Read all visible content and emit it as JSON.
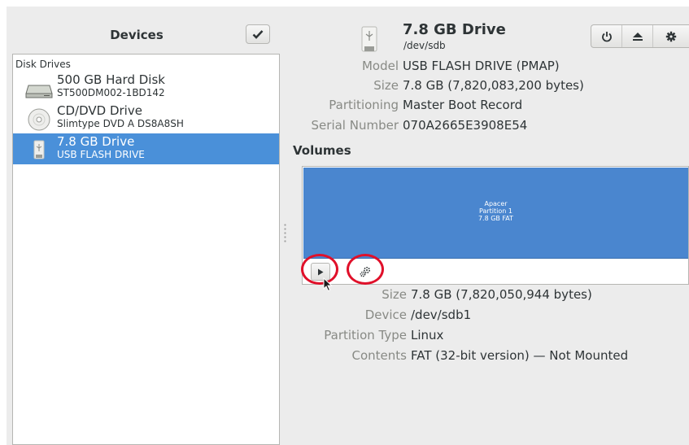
{
  "left_pane": {
    "title": "Devices",
    "section_header": "Disk Drives",
    "devices": [
      {
        "name": "500 GB Hard Disk",
        "sub": "ST500DM002-1BD142",
        "icon": "hard-disk-icon"
      },
      {
        "name": "CD/DVD Drive",
        "sub": "Slimtype DVD A  DS8A8SH",
        "icon": "optical-drive-icon"
      },
      {
        "name": "7.8 GB Drive",
        "sub": "USB FLASH DRIVE",
        "icon": "usb-drive-icon",
        "selected": true
      }
    ]
  },
  "drive": {
    "title": "7.8 GB Drive",
    "path": "/dev/sdb",
    "properties": [
      {
        "label": "Model",
        "value": "USB FLASH DRIVE (PMAP)"
      },
      {
        "label": "Size",
        "value": "7.8 GB (7,820,083,200 bytes)"
      },
      {
        "label": "Partitioning",
        "value": "Master Boot Record"
      },
      {
        "label": "Serial Number",
        "value": "070A2665E3908E54"
      }
    ],
    "header_buttons": [
      "power-off-icon",
      "eject-icon",
      "gear-icon"
    ]
  },
  "volumes": {
    "title": "Volumes",
    "partition": {
      "line1": "Apacer",
      "line2": "Partition 1",
      "line3": "7.8 GB FAT"
    },
    "properties": [
      {
        "label": "Size",
        "value": "7.8 GB (7,820,050,944 bytes)"
      },
      {
        "label": "Device",
        "value": "/dev/sdb1"
      },
      {
        "label": "Partition Type",
        "value": "Linux"
      },
      {
        "label": "Contents",
        "value": "FAT (32-bit version) — Not Mounted"
      }
    ]
  },
  "colors": {
    "selection": "#4a90d9",
    "partition": "#4a86cf",
    "annotation": "#e0102a",
    "label_gray": "#888a85"
  }
}
